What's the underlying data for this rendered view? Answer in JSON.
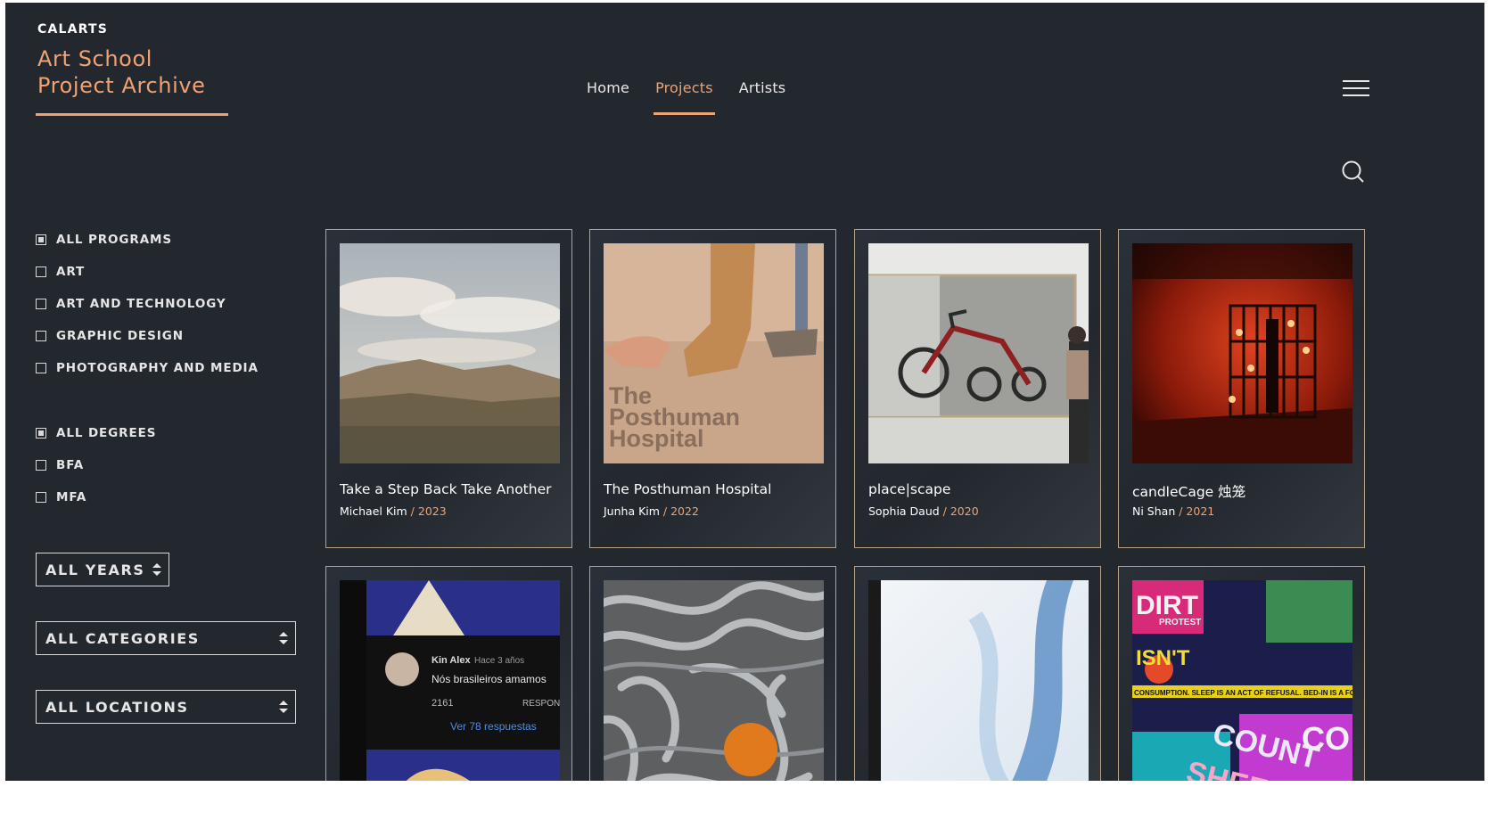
{
  "brand": {
    "kicker": "CALARTS",
    "title_line1": "Art School",
    "title_line2": "Project Archive"
  },
  "nav": {
    "items": [
      "Home",
      "Projects",
      "Artists"
    ],
    "active": "Projects"
  },
  "colors": {
    "accent": "#f0a272",
    "background": "#23272e",
    "text": "#e6e6e6"
  },
  "icons": {
    "menu": "hamburger-icon",
    "search": "search-icon"
  },
  "filters": {
    "programs": [
      {
        "label": "ALL PROGRAMS",
        "checked": true
      },
      {
        "label": "ART",
        "checked": false
      },
      {
        "label": "ART AND TECHNOLOGY",
        "checked": false
      },
      {
        "label": "GRAPHIC DESIGN",
        "checked": false
      },
      {
        "label": "PHOTOGRAPHY AND MEDIA",
        "checked": false
      }
    ],
    "degrees": [
      {
        "label": "ALL DEGREES",
        "checked": true
      },
      {
        "label": "BFA",
        "checked": false
      },
      {
        "label": "MFA",
        "checked": false
      }
    ],
    "selects": {
      "years": "ALL YEARS",
      "categories": "ALL CATEGORIES",
      "locations": "ALL LOCATIONS"
    }
  },
  "projects": [
    {
      "title": "Take a Step Back Take Another",
      "artist": "Michael Kim",
      "year": "2023"
    },
    {
      "title": "The Posthuman Hospital",
      "artist": "Junha Kim",
      "year": "2022",
      "thumb_text": [
        "The",
        "Posthuman",
        "Hospital"
      ]
    },
    {
      "title": "place|scape",
      "artist": "Sophia Daud",
      "year": "2020"
    },
    {
      "title": "candleCage 烛笼",
      "artist": "Ni Shan",
      "year": "2021"
    },
    {
      "thumb_text": {
        "user": "Kin Alex",
        "time": "Hace 3 años",
        "comment": "Nós brasileiros amamos",
        "likes": "2161",
        "reply": "RESPONDER",
        "replies": "Ver 78 respuestas"
      }
    },
    {},
    {},
    {
      "thumb_text": [
        "DIRT",
        "PROTEST",
        "ISN'T",
        "COUNT",
        "SHEEP",
        "CO",
        "CONSUMPTION. SLEEP IS AN ACT OF REFUSAL. BED-IN IS A FORM OF"
      ]
    }
  ]
}
